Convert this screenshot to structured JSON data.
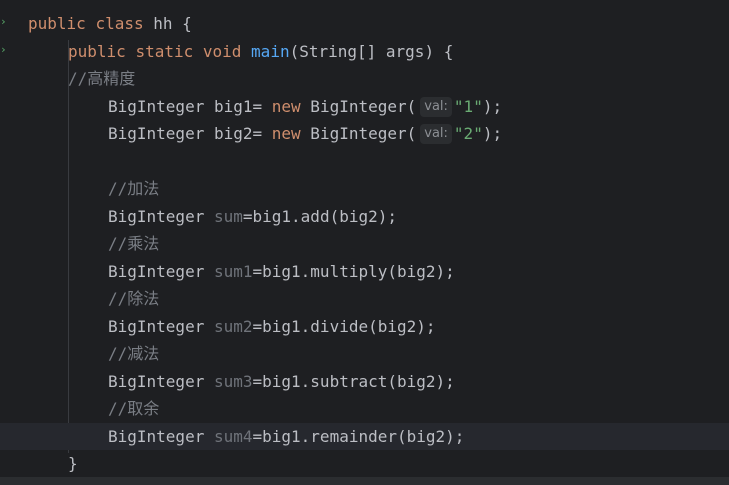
{
  "editor": {
    "gutter_icons": [
      "run-icon",
      "run-icon"
    ],
    "lines": {
      "l1": {
        "kw1": "public",
        "kw2": "class",
        "rest": " hh {"
      },
      "l2": {
        "kw1": "public",
        "kw2": "static",
        "kw3": "void",
        "fn": "main",
        "rest": "(String[] args) {"
      },
      "l3": {
        "cmt": "//高精度"
      },
      "l4": {
        "pre": "BigInteger big1= ",
        "kw": "new",
        "mid": " BigInteger(",
        "hint": "val:",
        "str": "\"1\"",
        "post": ");"
      },
      "l5": {
        "pre": "BigInteger big2= ",
        "kw": "new",
        "mid": " BigInteger(",
        "hint": "val:",
        "str": "\"2\"",
        "post": ");"
      },
      "l7": {
        "cmt": "//加法"
      },
      "l8": {
        "pre": "BigInteger ",
        "var": "sum",
        "post": "=big1.add(big2);"
      },
      "l9": {
        "cmt": "//乘法"
      },
      "l10": {
        "pre": "BigInteger ",
        "var": "sum1",
        "post": "=big1.multiply(big2);"
      },
      "l11": {
        "cmt": "//除法"
      },
      "l12": {
        "pre": "BigInteger ",
        "var": "sum2",
        "post": "=big1.divide(big2);"
      },
      "l13": {
        "cmt": "//减法"
      },
      "l14": {
        "pre": "BigInteger ",
        "var": "sum3",
        "post": "=big1.subtract(big2);"
      },
      "l15": {
        "cmt": "//取余"
      },
      "l16": {
        "pre": "BigInteger ",
        "var": "sum4",
        "post": "=big1.remainder(big2);"
      },
      "l17": {
        "rest": "}"
      }
    }
  },
  "colors": {
    "background": "#1e1f22",
    "keyword": "#cf8e6d",
    "function": "#56a8f5",
    "string": "#6aab73",
    "comment": "#7a7e85",
    "unused_variable": "#6f737a",
    "text": "#bcbec4"
  }
}
